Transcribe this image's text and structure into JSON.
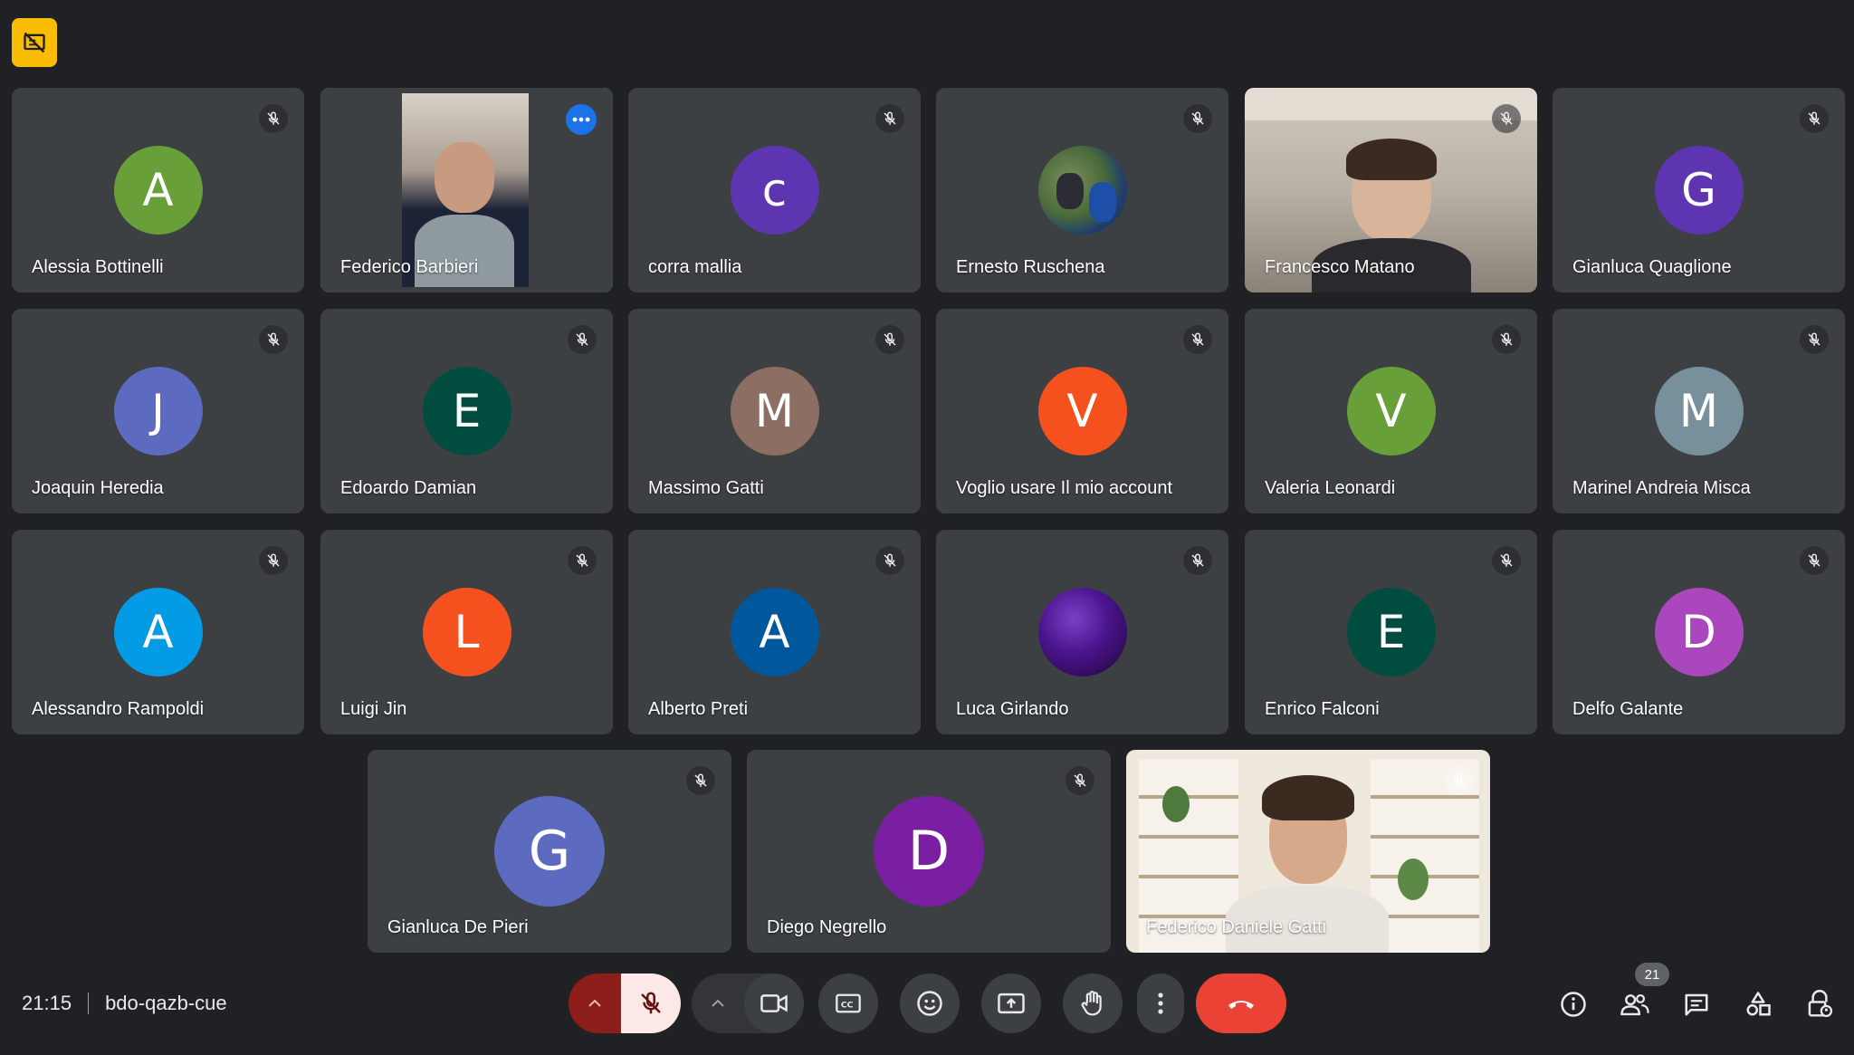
{
  "meeting": {
    "time": "21:15",
    "code": "bdo-qazb-cue",
    "participant_count": "21"
  },
  "colors": {
    "background": "#202124",
    "tile": "#3c4043",
    "active_outline": "#8ab4f8",
    "hangup": "#ea4335",
    "mic_muted_bg": "#fce8e6",
    "mic_muted_side": "#8c1d18",
    "notice": "#fbbc04"
  },
  "tiles": [
    {
      "name": "Alessia Bottinelli",
      "initial": "A",
      "avatar_color": "#689f38",
      "kind": "avatar"
    },
    {
      "name": "Federico Barbieri",
      "initial": "",
      "avatar_color": "",
      "kind": "video",
      "active": true
    },
    {
      "name": "corra mallia",
      "initial": "c",
      "avatar_color": "#5e35b1",
      "kind": "avatar"
    },
    {
      "name": "Ernesto Ruschena",
      "initial": "",
      "avatar_color": "#4a6a3a",
      "kind": "photo-avatar"
    },
    {
      "name": "Francesco Matano",
      "initial": "",
      "avatar_color": "",
      "kind": "video"
    },
    {
      "name": "Gianluca Quaglione",
      "initial": "G",
      "avatar_color": "#5e35b1",
      "kind": "avatar"
    },
    {
      "name": "Joaquin Heredia",
      "initial": "J",
      "avatar_color": "#5c6bc0",
      "kind": "avatar"
    },
    {
      "name": "Edoardo Damian",
      "initial": "E",
      "avatar_color": "#004d40",
      "kind": "avatar"
    },
    {
      "name": "Massimo Gatti",
      "initial": "M",
      "avatar_color": "#8d6e63",
      "kind": "avatar"
    },
    {
      "name": "Voglio usare Il mio account",
      "initial": "V",
      "avatar_color": "#f4511e",
      "kind": "avatar"
    },
    {
      "name": "Valeria Leonardi",
      "initial": "V",
      "avatar_color": "#689f38",
      "kind": "avatar"
    },
    {
      "name": "Marinel Andreia Misca",
      "initial": "M",
      "avatar_color": "#78909c",
      "kind": "avatar"
    },
    {
      "name": "Alessandro Rampoldi",
      "initial": "A",
      "avatar_color": "#039be5",
      "kind": "avatar"
    },
    {
      "name": "Luigi Jin",
      "initial": "L",
      "avatar_color": "#f4511e",
      "kind": "avatar"
    },
    {
      "name": "Alberto Preti",
      "initial": "A",
      "avatar_color": "#01579b",
      "kind": "avatar"
    },
    {
      "name": "Luca Girlando",
      "initial": "",
      "avatar_color": "#3b0a6b",
      "kind": "photo-avatar"
    },
    {
      "name": "Enrico Falconi",
      "initial": "E",
      "avatar_color": "#004d40",
      "kind": "avatar"
    },
    {
      "name": "Delfo Galante",
      "initial": "D",
      "avatar_color": "#ab47bc",
      "kind": "avatar"
    },
    {
      "name": "Gianluca De Pieri",
      "initial": "G",
      "avatar_color": "#5c6bc0",
      "kind": "avatar",
      "big": true
    },
    {
      "name": "Diego Negrello",
      "initial": "D",
      "avatar_color": "#7b1fa2",
      "kind": "avatar",
      "big": true
    },
    {
      "name": "Federico Daniele Gatti",
      "initial": "",
      "avatar_color": "",
      "kind": "video"
    }
  ],
  "controls": {
    "mic": "mic-off-icon",
    "camera": "videocam-icon",
    "captions": "captions-icon",
    "reactions": "emoji-icon",
    "present": "present-screen-icon",
    "raise_hand": "hand-icon",
    "more": "more-vert-icon",
    "leave": "call-end-icon"
  }
}
